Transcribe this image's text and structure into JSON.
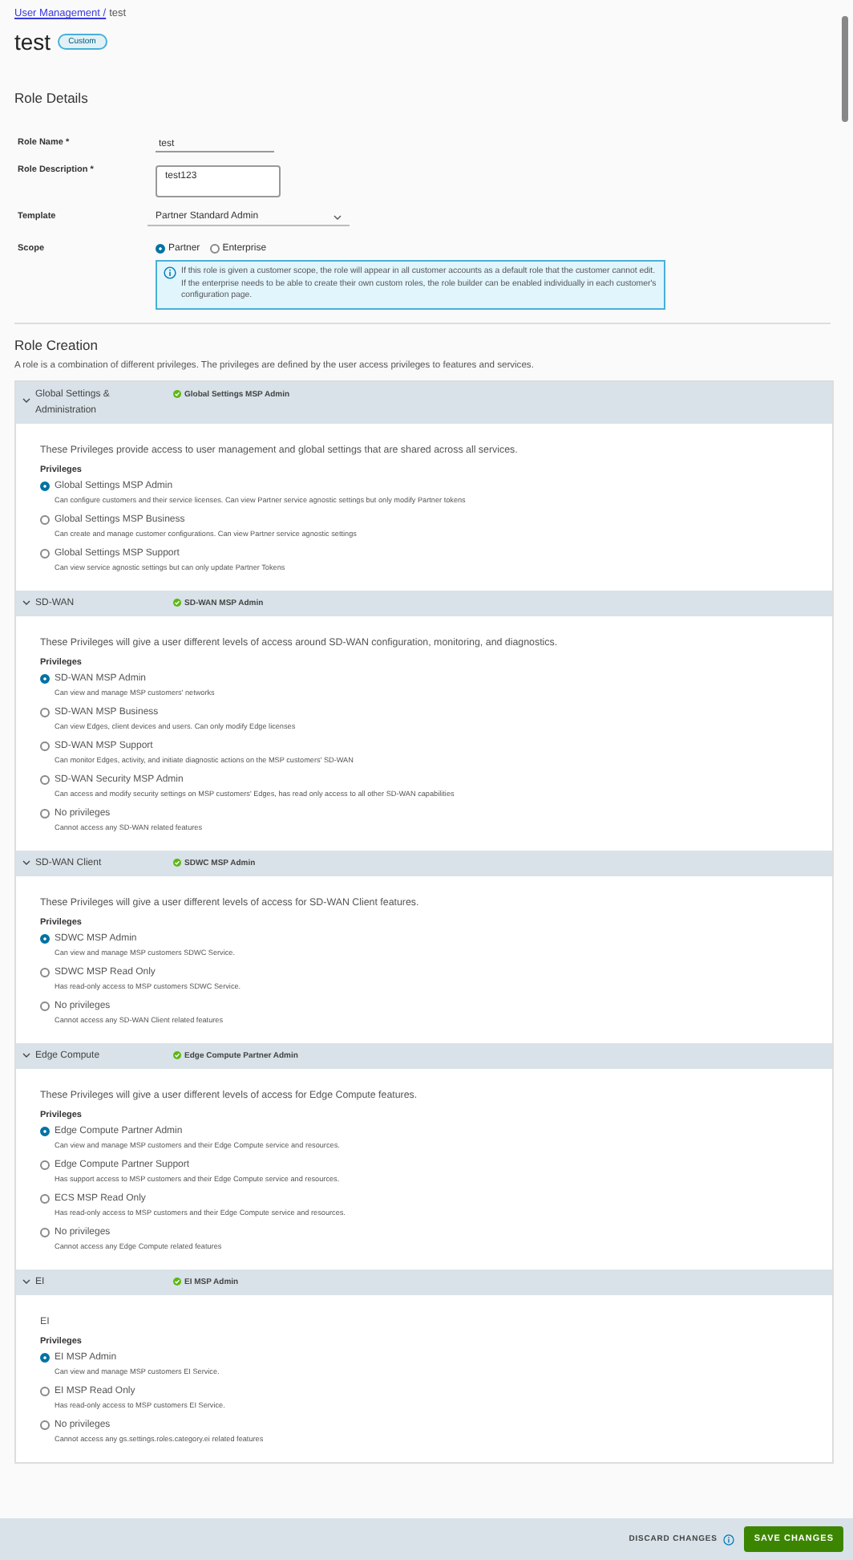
{
  "breadcrumb": {
    "link": "User Management /",
    "current": "test"
  },
  "title": "test",
  "badge": "Custom",
  "role_details": {
    "heading": "Role Details",
    "fields": [
      {
        "kind": "text",
        "label": "Role Name *",
        "value": "test"
      },
      {
        "kind": "textarea",
        "label": "Role Description *",
        "value": "test123"
      },
      {
        "kind": "select",
        "label": "Template",
        "value": "Partner Standard Admin"
      },
      {
        "kind": "radio",
        "label": "Scope",
        "options": [
          {
            "label": "Partner",
            "selected": true
          },
          {
            "label": "Enterprise",
            "selected": false
          }
        ],
        "info": "If this role is given a customer scope, the role will appear in all customer accounts as a default role that the customer cannot edit. If the enterprise needs to be able to create their own custom roles, the role builder can be enabled individually in each customer's configuration page."
      }
    ]
  },
  "role_creation": {
    "heading": "Role Creation",
    "description": "A role is a combination of different privileges. The privileges are defined by the user access privileges to features and services.",
    "sections": [
      {
        "title": "Global Settings & Administration",
        "expanded": true,
        "summary": "Global Settings MSP Admin",
        "intro": "These Privileges provide access to user management and global settings that are shared across all services.",
        "privileges_label": "Privileges",
        "options": [
          {
            "label": "Global Settings MSP Admin",
            "description": "Can configure customers and their service licenses. Can view Partner service agnostic settings but only modify Partner tokens",
            "selected": true
          },
          {
            "label": "Global Settings MSP Business",
            "description": "Can create and manage customer configurations. Can view Partner service agnostic settings",
            "selected": false
          },
          {
            "label": "Global Settings MSP Support",
            "description": "Can view service agnostic settings but can only update Partner Tokens",
            "selected": false
          }
        ]
      },
      {
        "title": "SD-WAN",
        "expanded": true,
        "summary": "SD-WAN MSP Admin",
        "intro": "These Privileges will give a user different levels of access around SD-WAN configuration, monitoring, and diagnostics.",
        "privileges_label": "Privileges",
        "options": [
          {
            "label": "SD-WAN MSP Admin",
            "description": "Can view and manage MSP customers' networks",
            "selected": true
          },
          {
            "label": "SD-WAN MSP Business",
            "description": "Can view Edges, client devices and users. Can only modify Edge licenses",
            "selected": false
          },
          {
            "label": "SD-WAN MSP Support",
            "description": "Can monitor Edges, activity, and initiate diagnostic actions on the MSP customers' SD-WAN",
            "selected": false
          },
          {
            "label": "SD-WAN Security MSP Admin",
            "description": "Can access and modify security settings on MSP customers' Edges, has read only access to all other SD-WAN capabilities",
            "selected": false
          },
          {
            "label": "No privileges",
            "description": "Cannot access any SD-WAN related features",
            "selected": false
          }
        ]
      },
      {
        "title": "SD-WAN Client",
        "expanded": true,
        "summary": "SDWC MSP Admin",
        "intro": "These Privileges will give a user different levels of access for SD-WAN Client features.",
        "privileges_label": "Privileges",
        "options": [
          {
            "label": "SDWC MSP Admin",
            "description": "Can view and manage MSP customers SDWC Service.",
            "selected": true
          },
          {
            "label": "SDWC MSP Read Only",
            "description": "Has read-only access to MSP customers SDWC Service.",
            "selected": false
          },
          {
            "label": "No privileges",
            "description": "Cannot access any SD-WAN Client related features",
            "selected": false
          }
        ]
      },
      {
        "title": "Edge Compute",
        "expanded": true,
        "summary": "Edge Compute Partner Admin",
        "intro": "These Privileges will give a user different levels of access for Edge Compute features.",
        "privileges_label": "Privileges",
        "options": [
          {
            "label": "Edge Compute Partner Admin",
            "description": "Can view and manage MSP customers and their Edge Compute service and resources.",
            "selected": true
          },
          {
            "label": "Edge Compute Partner Support",
            "description": "Has support access to MSP customers and their Edge Compute service and resources.",
            "selected": false
          },
          {
            "label": "ECS MSP Read Only",
            "description": "Has read-only access to MSP customers and their Edge Compute service and resources.",
            "selected": false
          },
          {
            "label": "No privileges",
            "description": "Cannot access any Edge Compute related features",
            "selected": false
          }
        ]
      },
      {
        "title": "EI",
        "expanded": true,
        "summary": "EI MSP Admin",
        "intro": "EI",
        "privileges_label": "Privileges",
        "options": [
          {
            "label": "EI MSP Admin",
            "description": "Can view and manage MSP customers EI Service.",
            "selected": true
          },
          {
            "label": "EI MSP Read Only",
            "description": "Has read-only access to MSP customers EI Service.",
            "selected": false
          },
          {
            "label": "No privileges",
            "description": "Cannot access any gs.settings.roles.category.ei related features",
            "selected": false
          }
        ]
      }
    ]
  },
  "footer": {
    "discard": "DISCARD CHANGES",
    "save": "SAVE CHANGES"
  }
}
